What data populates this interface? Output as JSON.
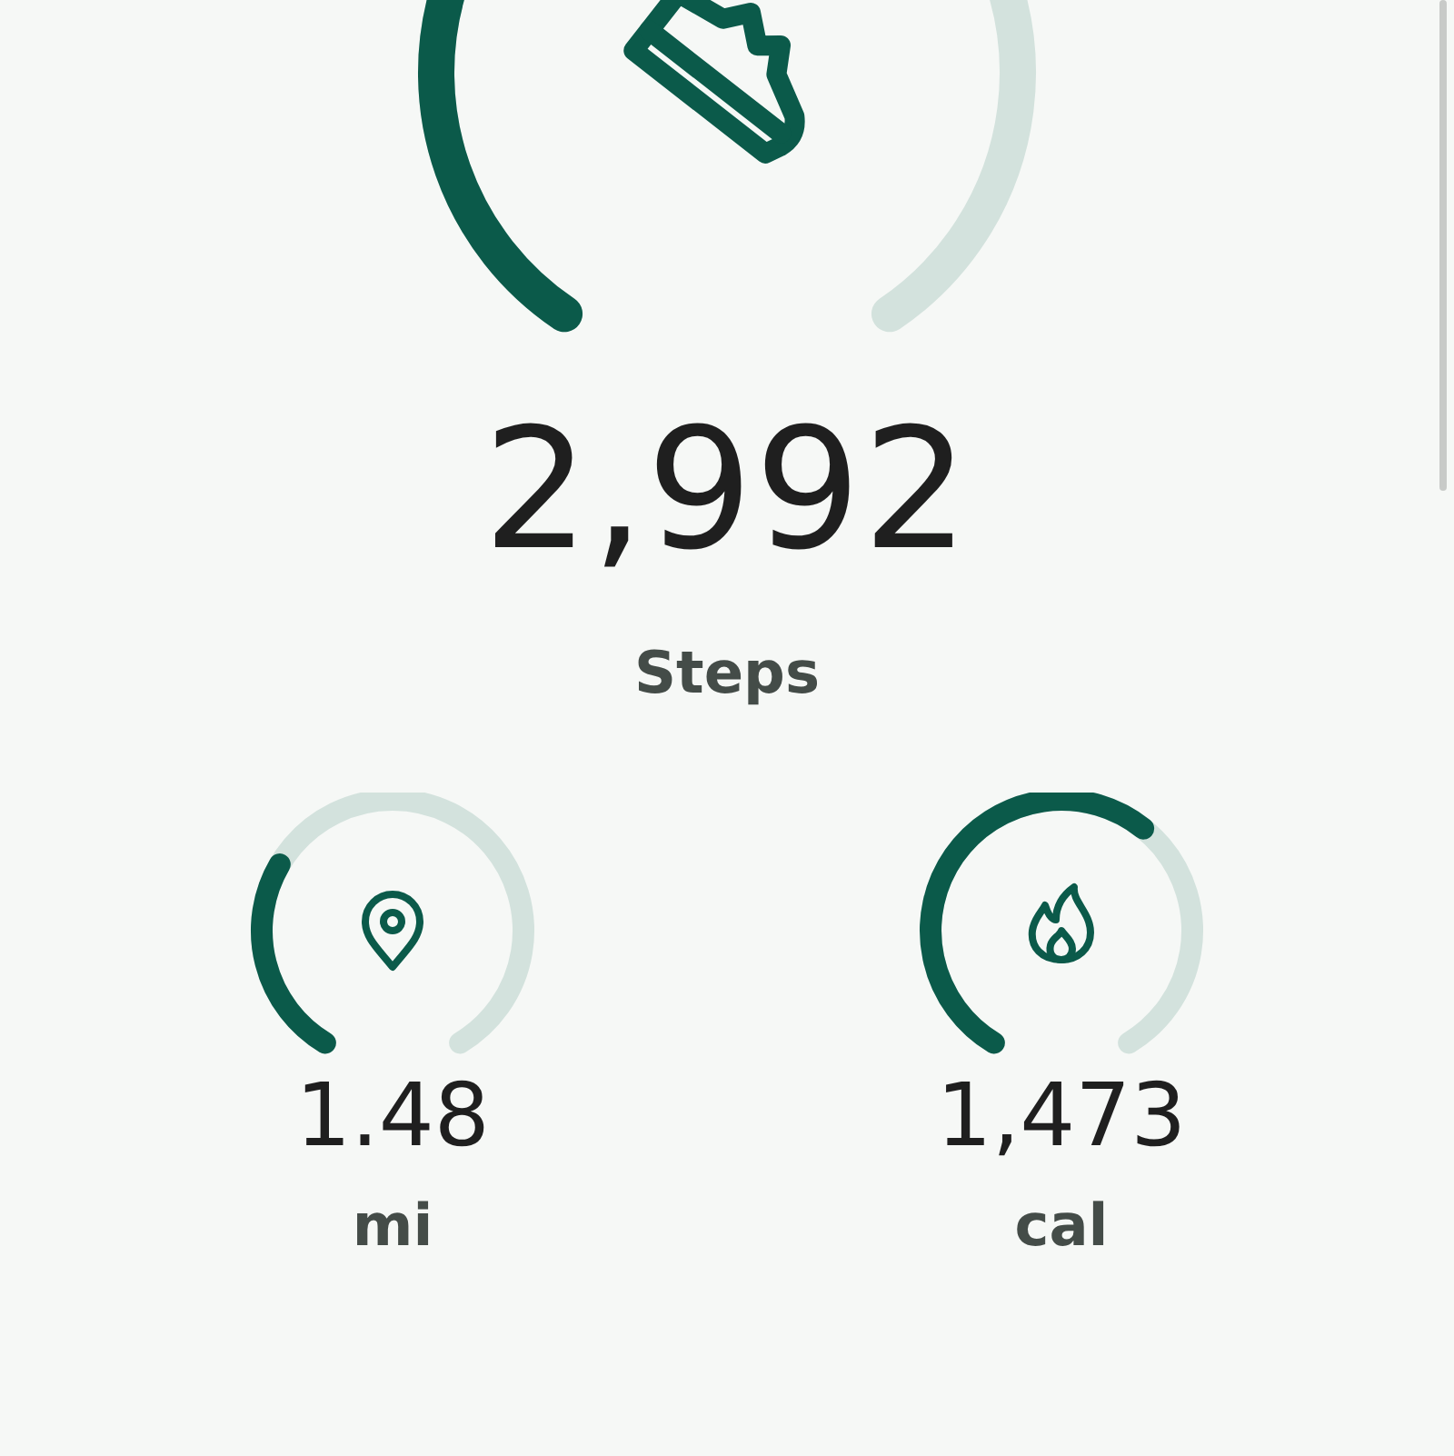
{
  "steps": {
    "value": "2,992",
    "label": "Steps"
  },
  "metrics": [
    {
      "kind": "distance",
      "value": "1.48",
      "unit": "mi"
    },
    {
      "kind": "calories",
      "value": "1,473",
      "unit": "cal"
    }
  ]
}
